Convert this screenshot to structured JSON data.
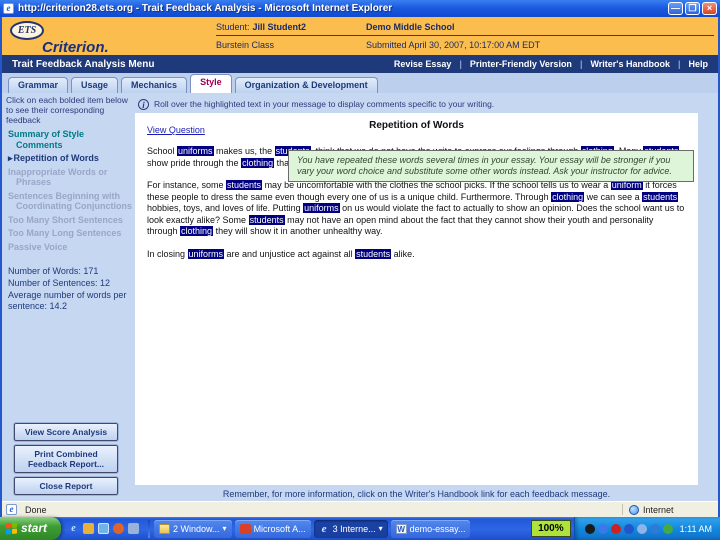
{
  "window": {
    "title": "http://criterion28.ets.org - Trait Feedback Analysis - Microsoft Internet Explorer"
  },
  "colors": {
    "header_orange": "#FBBE4E",
    "navy": "#1E3A7B",
    "highlight_navy": "#000080",
    "tooltip_green": "#DFF5DA",
    "active_tab_text": "#A00050"
  },
  "header": {
    "ets": "ETS",
    "criterion": "Criterion.",
    "student_label": "Student:",
    "student_name": "Jill Student2",
    "class_name": "Burstein Class",
    "school": "Demo Middle School",
    "submitted": "Submitted April 30, 2007, 10:17:00 AM EDT"
  },
  "menubar": {
    "title": "Trait Feedback Analysis Menu",
    "links": [
      "Revise Essay",
      "Printer-Friendly Version",
      "Writer's Handbook",
      "Help"
    ]
  },
  "tabs": [
    {
      "label": "Grammar",
      "active": false
    },
    {
      "label": "Usage",
      "active": false
    },
    {
      "label": "Mechanics",
      "active": false
    },
    {
      "label": "Style",
      "active": true
    },
    {
      "label": "Organization & Development",
      "active": false
    }
  ],
  "sidebar": {
    "intro": "Click on each bolded item below to see their corresponding feedback",
    "items": [
      {
        "label": "Summary of Style Comments",
        "style": "summary"
      },
      {
        "label": "Repetition of Words",
        "style": "selected"
      },
      {
        "label": "Inappropriate Words or Phrases",
        "style": "disabled"
      },
      {
        "label": "Sentences Beginning with Coordinating Conjunctions",
        "style": "disabled"
      },
      {
        "label": "Too Many Short Sentences",
        "style": "disabled"
      },
      {
        "label": "Too Many Long Sentences",
        "style": "disabled"
      },
      {
        "label": "Passive Voice",
        "style": "disabled"
      }
    ],
    "stats": [
      "Number of Words: 171",
      "Number of Sentences: 12",
      "Average number of words per sentence: 14.2"
    ],
    "buttons": [
      "View Score Analysis",
      "Print Combined Feedback Report...",
      "Close Report"
    ]
  },
  "content": {
    "info": "Roll over the highlighted text in your message to display comments specific to your writing.",
    "view_question": "View Question",
    "title": "Repetition of Words",
    "tooltip": "You have repeated these words several times in your essay. Your essay will be stronger if you vary your word choice and substitute some other words instead. Ask your instructor for advice.",
    "reminder": "Remember, for more information, click on the Writer's Handbook link for each feedback message.",
    "essay": [
      [
        {
          "t": "School ",
          "hl": false
        },
        {
          "t": "uniforms",
          "hl": true
        },
        {
          "t": " makes us, the ",
          "hl": false
        },
        {
          "t": "students",
          "hl": true
        },
        {
          "t": ", think that we do not have the write to express our feelings through ",
          "hl": false
        },
        {
          "t": "clothing",
          "hl": true
        },
        {
          "t": ". Many ",
          "hl": false
        },
        {
          "t": "students",
          "hl": true
        },
        {
          "t": " show pride through the ",
          "hl": false
        },
        {
          "t": "clothing",
          "hl": true
        },
        {
          "t": " that they wear.",
          "hl": false
        }
      ],
      [
        {
          "t": "For instance, some ",
          "hl": false
        },
        {
          "t": "students",
          "hl": true
        },
        {
          "t": " may be uncomfortable with the clothes the school picks. If the school tells us to wear a ",
          "hl": false
        },
        {
          "t": "uniform",
          "hl": true
        },
        {
          "t": " it forces these people to dress the same even though every one of us is a unique child. Furthermore. Through ",
          "hl": false
        },
        {
          "t": "clothing",
          "hl": true
        },
        {
          "t": " we can see a ",
          "hl": false
        },
        {
          "t": "students",
          "hl": true
        },
        {
          "t": " hobbies, toys, and loves of life. Putting ",
          "hl": false
        },
        {
          "t": "uniforms",
          "hl": true
        },
        {
          "t": " on us would violate the fact to actually to show an opinion. Does the school want us to look exactly alike? Some ",
          "hl": false
        },
        {
          "t": "students",
          "hl": true
        },
        {
          "t": " may not have an open mind about the fact that they cannot show their youth and personality through ",
          "hl": false
        },
        {
          "t": "clothing",
          "hl": true
        },
        {
          "t": " they will show it in another unhealthy way.",
          "hl": false
        }
      ],
      [
        {
          "t": "In closing ",
          "hl": false
        },
        {
          "t": "uniforms",
          "hl": true
        },
        {
          "t": " are and unjustice act against all ",
          "hl": false
        },
        {
          "t": "students",
          "hl": true
        },
        {
          "t": " alike.",
          "hl": false
        }
      ]
    ]
  },
  "statusbar": {
    "status": "Done",
    "zone": "Internet"
  },
  "taskbar": {
    "start": "start",
    "quick_launch": [
      {
        "name": "ie-quicklaunch-icon",
        "type": "ie",
        "glyph": "e"
      },
      {
        "name": "mail-quicklaunch-icon",
        "type": "mail",
        "glyph": ""
      },
      {
        "name": "show-desktop-icon",
        "type": "desk",
        "glyph": ""
      },
      {
        "name": "media-player-quicklaunch-icon",
        "type": "media",
        "glyph": ""
      },
      {
        "name": "app-quicklaunch-icon",
        "type": "app",
        "glyph": ""
      }
    ],
    "tasks": [
      {
        "label": "2 Window...",
        "icon": "folder",
        "arrow": true,
        "active": false
      },
      {
        "label": "Microsoft A...",
        "icon": "app-red",
        "arrow": false,
        "active": false
      },
      {
        "label": "3 Interne...",
        "icon": "ie",
        "arrow": true,
        "active": true
      },
      {
        "label": "demo-essay...",
        "icon": "word",
        "arrow": false,
        "active": false
      }
    ],
    "zoom_level": "100%",
    "tray_icons": [
      {
        "name": "volume-icon",
        "color": "#1A1A1A"
      },
      {
        "name": "messenger-icon",
        "color": "#3B78E8"
      },
      {
        "name": "alert-icon",
        "color": "#CC2222"
      },
      {
        "name": "pause-icon",
        "color": "#2255CC"
      },
      {
        "name": "clock-icon",
        "color": "#8FB4E8"
      },
      {
        "name": "player-icon",
        "color": "#2E7BD6"
      },
      {
        "name": "network-icon",
        "color": "#44AA44"
      }
    ],
    "time": "1:11 AM"
  }
}
